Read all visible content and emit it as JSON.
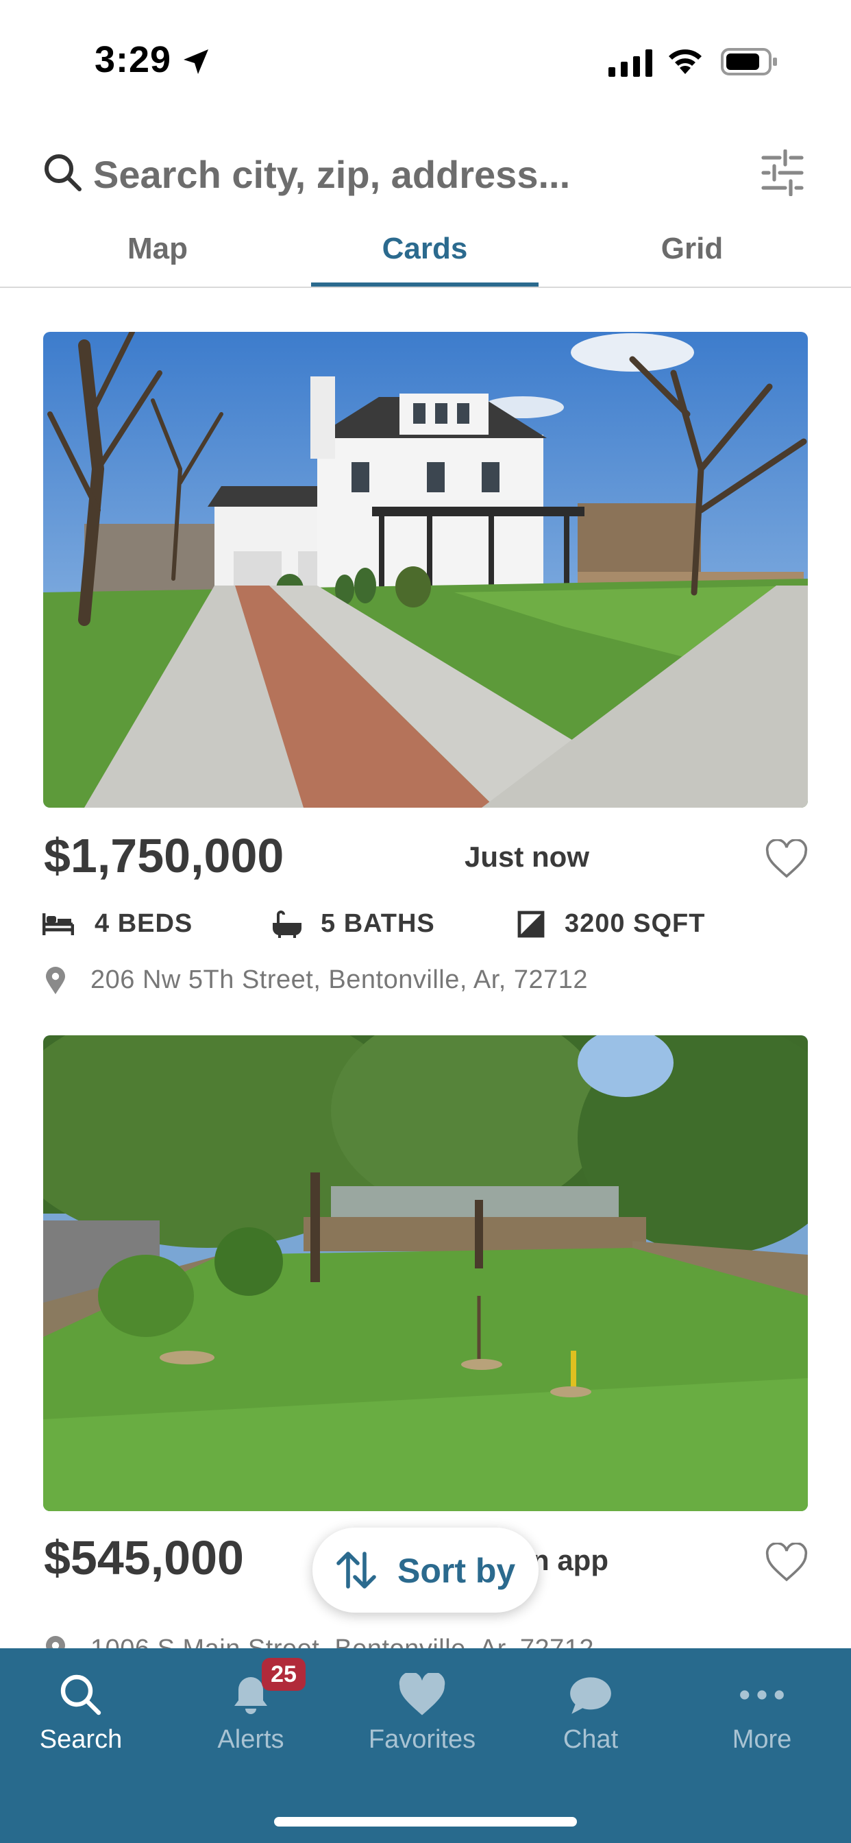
{
  "status_bar": {
    "time": "3:29"
  },
  "search": {
    "placeholder": "Search city, zip, address..."
  },
  "tabs": [
    {
      "label": "Map",
      "active": false
    },
    {
      "label": "Cards",
      "active": true
    },
    {
      "label": "Grid",
      "active": false
    }
  ],
  "listings": [
    {
      "price": "$1,750,000",
      "listed": "Just now",
      "beds": "4 BEDS",
      "baths": "5 BATHS",
      "sqft": "3200 SQFT",
      "address": "206 Nw 5Th Street, Bentonville, Ar, 72712",
      "photo_subject": "two-story white house with paver walkway"
    },
    {
      "price": "$545,000",
      "listed": "n app",
      "address": "1006 S Main Street, Bentonville, Ar, 72712",
      "photo_subject": "grassy vacant lot with trees"
    }
  ],
  "sort": {
    "label": "Sort by"
  },
  "bottom_nav": [
    {
      "label": "Search",
      "icon": "search-icon",
      "active": true
    },
    {
      "label": "Alerts",
      "icon": "bell-icon",
      "badge": "25"
    },
    {
      "label": "Favorites",
      "icon": "heart-icon"
    },
    {
      "label": "Chat",
      "icon": "chat-bubble-icon"
    },
    {
      "label": "More",
      "icon": "more-dots-icon"
    }
  ],
  "colors": {
    "accent": "#2b6a8e",
    "nav_bg": "#286a8d",
    "badge": "#b12a3a"
  }
}
